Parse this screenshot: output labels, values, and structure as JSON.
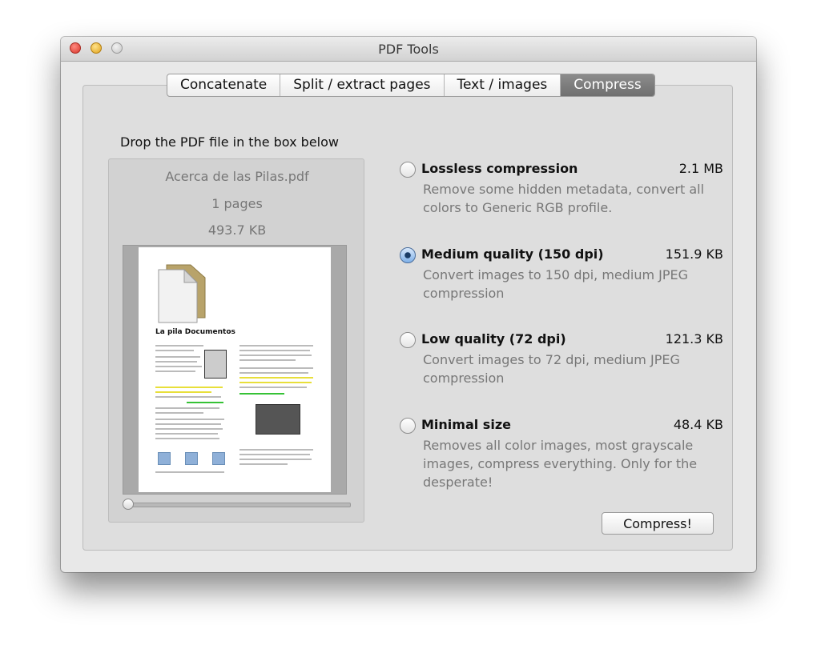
{
  "window": {
    "title": "PDF Tools"
  },
  "tabs": [
    {
      "label": "Concatenate",
      "active": false
    },
    {
      "label": "Split / extract pages",
      "active": false
    },
    {
      "label": "Text / images",
      "active": false
    },
    {
      "label": "Compress",
      "active": true
    }
  ],
  "drop_area": {
    "instruction": "Drop the PDF file in the box below",
    "file_name": "Acerca de las Pilas.pdf",
    "pages": "1 pages",
    "size": "493.7 KB",
    "preview": {
      "heading": "La pila Documentos"
    }
  },
  "options": [
    {
      "title": "Lossless compression",
      "size": "2.1 MB",
      "description": "Remove some hidden metadata, convert all colors to Generic RGB profile.",
      "selected": false
    },
    {
      "title": "Medium quality (150 dpi)",
      "size": "151.9 KB",
      "description": "Convert images to 150 dpi, medium JPEG compression",
      "selected": true
    },
    {
      "title": "Low quality (72 dpi)",
      "size": "121.3 KB",
      "description": "Convert images to 72 dpi, medium JPEG compression",
      "selected": false
    },
    {
      "title": "Minimal size",
      "size": "48.4 KB",
      "description": "Removes all color images, most grayscale images, compress everything. Only for the desperate!",
      "selected": false
    }
  ],
  "actions": {
    "compress_label": "Compress!"
  },
  "colors": {
    "tab_active": "#7a7a7a",
    "radio_selected": "#7fb0e8"
  }
}
